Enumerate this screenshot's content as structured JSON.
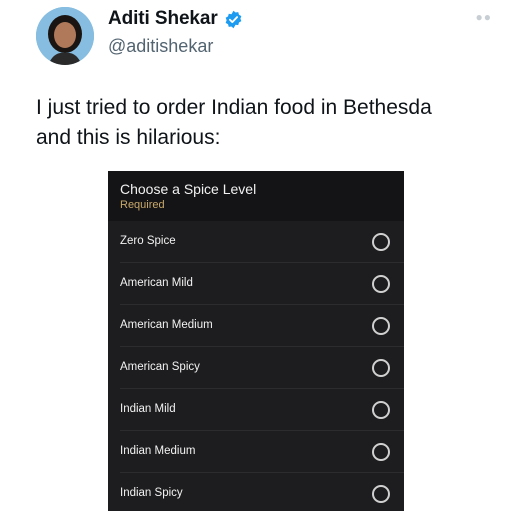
{
  "author": {
    "display_name": "Aditi Shekar",
    "handle": "@aditishekar",
    "verified_icon": "verified-badge-icon",
    "verified_color": "#1d9bf0"
  },
  "more_icon": "more-dots-icon",
  "tweet": {
    "line1": "I just tried to order Indian food in Bethesda",
    "line2": "and this is hilarious:"
  },
  "media": {
    "title": "Choose a Spice Level",
    "required": "Required",
    "options": [
      {
        "label": "Zero Spice"
      },
      {
        "label": "American Mild"
      },
      {
        "label": "American Medium"
      },
      {
        "label": "American Spicy"
      },
      {
        "label": "Indian Mild"
      },
      {
        "label": "Indian Medium"
      },
      {
        "label": "Indian Spicy"
      }
    ]
  }
}
